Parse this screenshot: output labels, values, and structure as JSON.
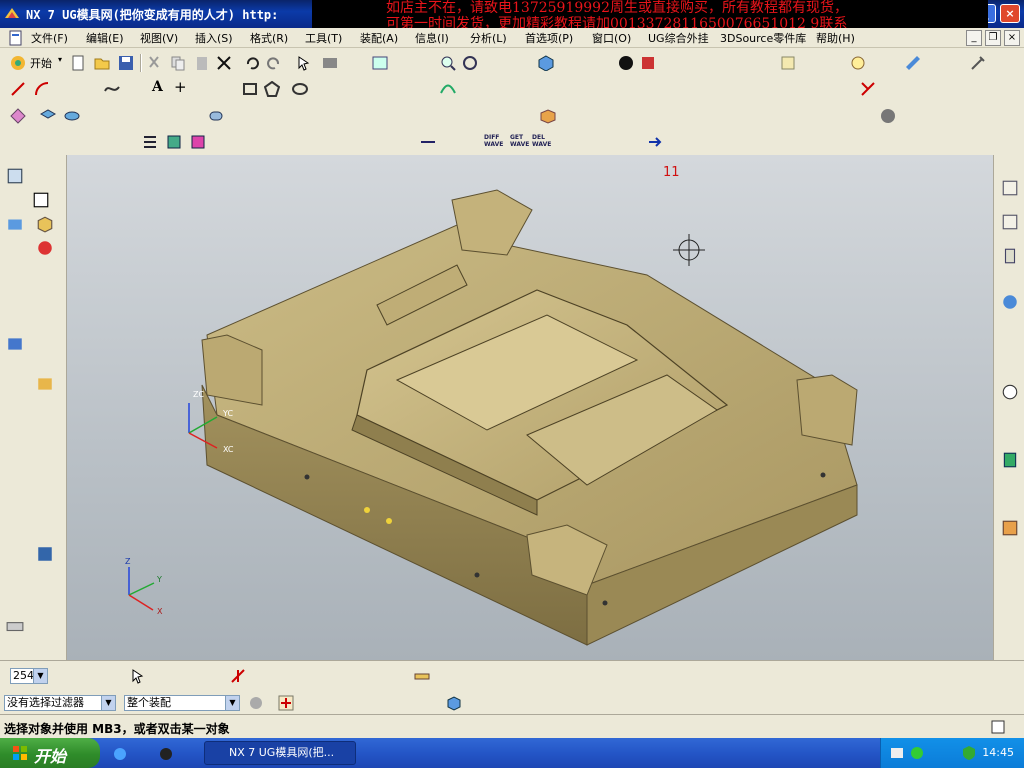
{
  "titlebar": {
    "title": "NX 7 UG模具网(把你变成有用的人才) http:",
    "ad_line1": "如店主不在，请致电13725919992周生或直接购买，所有教程都有现货，",
    "ad_line2": "可第一时间发货，更加精彩教程请加0013372811650076651012 9联系"
  },
  "menu": {
    "items": [
      "文件(F)",
      "编辑(E)",
      "视图(V)",
      "插入(S)",
      "格式(R)",
      "工具(T)",
      "装配(A)",
      "信息(I)",
      "分析(L)",
      "首选项(P)",
      "窗口(O)",
      "UG综合外挂",
      "3DSource零件库",
      "帮助(H)"
    ]
  },
  "toolbar": {
    "start_label": "开始"
  },
  "viewport": {
    "annotation": "11",
    "wcs_labels": {
      "z": "ZC",
      "y": "YC",
      "x": "XC"
    },
    "triad_labels": {
      "z": "Z",
      "y": "Y",
      "x": "X"
    }
  },
  "bottom_toolbar": {
    "zoom_value": "254"
  },
  "selection": {
    "filter_value": "没有选择过滤器",
    "scope_value": "整个装配"
  },
  "status": {
    "text": "选择对象并使用 MB3，或者双击某一对象"
  },
  "taskbar": {
    "start": "开始",
    "task_label": "NX 7 UG模具网(把...",
    "clock": "14:45"
  },
  "colors": {
    "part": "#b5a36c",
    "part_dark": "#8f7f4e",
    "part_light": "#cdbd88",
    "annotation": "#d01010",
    "taskbar": "#2456c7"
  }
}
